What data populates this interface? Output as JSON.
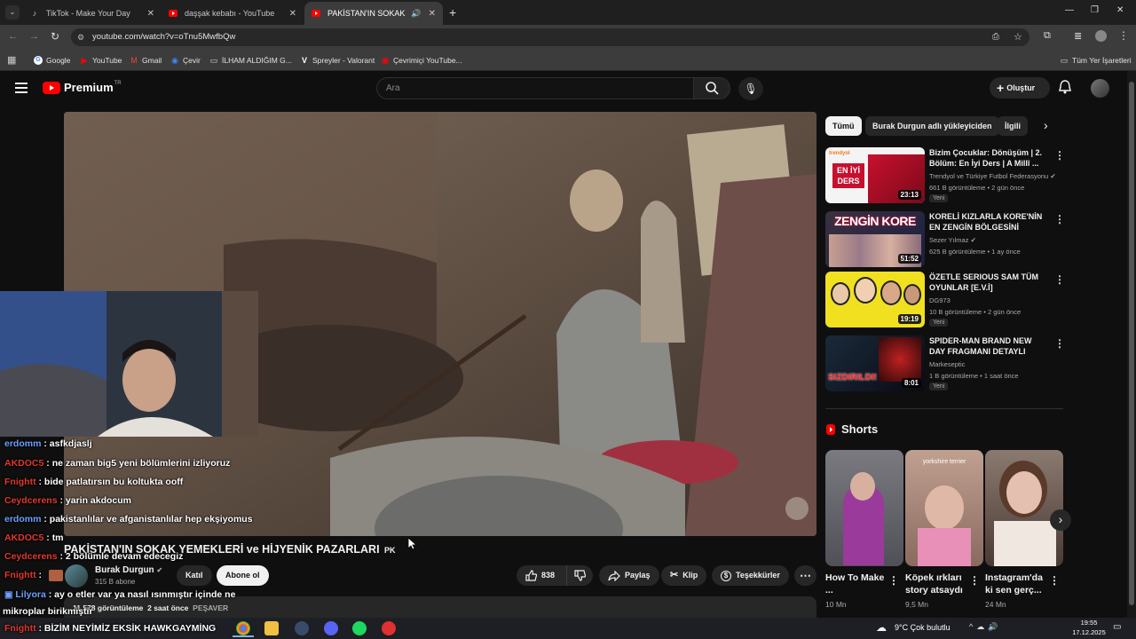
{
  "browser": {
    "tabs": [
      {
        "title": "TikTok - Make Your Day",
        "icon": "tiktok-icon"
      },
      {
        "title": "daşşak kebabı - YouTube",
        "icon": "youtube-icon"
      },
      {
        "title": "PAKİSTAN'IN SOKAK YEMEKLERİ",
        "icon": "youtube-icon",
        "active": true
      }
    ],
    "url": "youtube.com/watch?v=oTnu5MwfbQw",
    "bookmarks": [
      "Google",
      "YouTube",
      "Gmail",
      "Çevir",
      "İLHAM ALDIĞIM G...",
      "Spreyler - Valorant",
      "Çevrimiçi YouTube..."
    ],
    "all_bookmarks": "Tüm Yer İşaretleri"
  },
  "yt": {
    "logo_text": "Premium",
    "logo_badge": "TR",
    "search_placeholder": "Ara",
    "create_label": "Oluştur",
    "brand_color": "#ff0000"
  },
  "video": {
    "title": "PAKİSTAN'IN SOKAK YEMEKLERİ ve HİJYENİK PAZARLARI",
    "title_suffix": "PK",
    "channel": "Burak Durgun",
    "subscribers": "315 B abone",
    "join_label": "Katıl",
    "subscribe_label": "Abone ol",
    "likes": "838",
    "share_label": "Paylaş",
    "clip_label": "Klip",
    "thanks_label": "Teşekkürler",
    "views": "11.578 görüntüleme",
    "age": "2 saat önce",
    "tag": "PEŞAVER"
  },
  "chat": [
    {
      "user": "erdomm",
      "color": "#6ea0ff",
      "msg": "asfkdjaslj"
    },
    {
      "user": "AKDOC5",
      "color": "#e0382e",
      "msg": "ne zaman big5 yeni bölümlerini izliyoruz"
    },
    {
      "user": "Fnightt",
      "color": "#e0382e",
      "msg": "bide patlatırsın bu koltukta ooff"
    },
    {
      "user": "Ceydcerens",
      "color": "#e0382e",
      "msg": "yarin akdocum"
    },
    {
      "user": "erdomm",
      "color": "#6ea0ff",
      "msg": "pakistanlılar ve afganistanlılar hep ekşiyomus"
    },
    {
      "user": "AKDOC5",
      "color": "#e0382e",
      "msg": "tm"
    },
    {
      "user": "Ceydcerens",
      "color": "#e0382e",
      "msg": "2 bölümle devam edecegiz"
    },
    {
      "user": "Fnightt",
      "color": "#e0382e",
      "msg": ""
    },
    {
      "user": "Lilyora",
      "color": "#6ea0ff",
      "msg": "ay o etler var ya nasıl ısınmıştır içinde ne"
    },
    {
      "user": "",
      "color": "#ffffff",
      "msg": "mikroplar birikmiştir"
    },
    {
      "user": "Fnightt",
      "color": "#e0382e",
      "msg": "BİZİM NEYİMİZ EKSİK HAWKGAYMİNG"
    }
  ],
  "filters": [
    "Tümü",
    "Burak Durgun adlı yükleyiciden",
    "İlgili"
  ],
  "recommendations": [
    {
      "title": "Bizim Çocuklar: Dönüşüm | 2. Bölüm: En İyi Ders | A Millî ...",
      "channel": "Trendyol ve Türkiye Futbol Federasyonu",
      "meta": "661 B görüntüleme • 2 gün önce",
      "badge": "Yeni",
      "duration": "23:13",
      "thumb_text": "EN İYİ DERS",
      "thumb_color": "#c8102e"
    },
    {
      "title": "KORELİ KIZLARLA KORE'NİN EN ZENGİN BÖLGESİNİ GEZDİM!",
      "channel": "Sezer Yılmaz",
      "meta": "625 B görüntüleme • 1 ay önce",
      "badge": "",
      "duration": "51:52",
      "thumb_text": "ZENGİN KORE",
      "thumb_color": "#2a3050"
    },
    {
      "title": "ÖZETLE SERIOUS SAM TÜM OYUNLAR [E.V.İ]",
      "channel": "DG973",
      "meta": "10 B görüntüleme • 2 gün önce",
      "badge": "Yeni",
      "duration": "19:19",
      "thumb_text": "",
      "thumb_color": "#f0e020"
    },
    {
      "title": "SPIDER-MAN BRAND NEW DAY FRAGMANI DETAYLI İNCELEM...",
      "channel": "Markeseptic",
      "meta": "1 B görüntüleme • 1 saat önce",
      "badge": "Yeni",
      "duration": "8:01",
      "thumb_text": "SIZDIRILDI!",
      "thumb_color": "#1a1a22"
    }
  ],
  "shorts_label": "Shorts",
  "shorts": [
    {
      "title": "How To Make ...",
      "views": "10 Mn",
      "overlay": "",
      "color": "#6a6a70"
    },
    {
      "title": "Köpek ırkları story atsaydı",
      "views": "9,5 Mn",
      "overlay": "yorkshire terrier",
      "color": "#b08a78"
    },
    {
      "title": "Instagram'da ki sen gerç...",
      "views": "24 Mn",
      "overlay": "",
      "color": "#7a6a60"
    }
  ],
  "taskbar": {
    "weather": "9°C  Çok bulutlu",
    "time": "19:55",
    "date": "17.12.2025"
  }
}
